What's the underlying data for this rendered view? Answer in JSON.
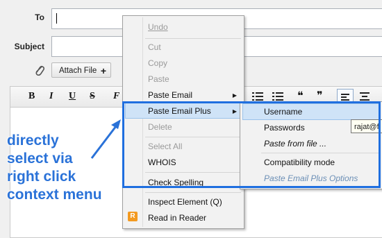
{
  "compose": {
    "to_label": "To",
    "subject_label": "Subject",
    "attach_label": "Attach File",
    "attach_plus": "+"
  },
  "toolbar": {
    "bold": "B",
    "italic": "I",
    "underline": "U",
    "strike": "S",
    "font": "F",
    "quote_open": "❝",
    "quote_close": "❞"
  },
  "context_menu": {
    "items": [
      {
        "label": "Undo",
        "enabled": false
      },
      {
        "label": "Cut",
        "enabled": false
      },
      {
        "label": "Copy",
        "enabled": false
      },
      {
        "label": "Paste",
        "enabled": false
      },
      {
        "label": "Paste Email",
        "enabled": true,
        "submenu": true
      },
      {
        "label": "Paste Email Plus",
        "enabled": true,
        "submenu": true,
        "highlighted": true
      },
      {
        "label": "Delete",
        "enabled": false
      },
      {
        "label": "Select All",
        "enabled": false
      },
      {
        "label": "WHOIS",
        "enabled": true
      },
      {
        "label": "Check Spelling",
        "enabled": true
      },
      {
        "label": "Inspect Element (Q)",
        "enabled": true
      },
      {
        "label": "Read in Reader",
        "enabled": true
      }
    ]
  },
  "submenu": {
    "items": [
      {
        "label": "Username",
        "highlighted": true
      },
      {
        "label": "Passwords"
      },
      {
        "label": "Paste from file ...",
        "italic": true
      },
      {
        "label": "Compatibility mode"
      },
      {
        "label": "Paste Email Plus Options",
        "disabled": true
      }
    ]
  },
  "tooltip": {
    "text": "rajat@f"
  },
  "annotation": {
    "lines": [
      "directly",
      "select via",
      "right click",
      "context menu"
    ],
    "color": "#2a72d8"
  },
  "colors": {
    "highlight_box": "#1f6fe0",
    "menu_highlight": "#cfe3f7"
  },
  "icons": {
    "attachment": "paperclip-icon",
    "reader": "reader-icon"
  }
}
